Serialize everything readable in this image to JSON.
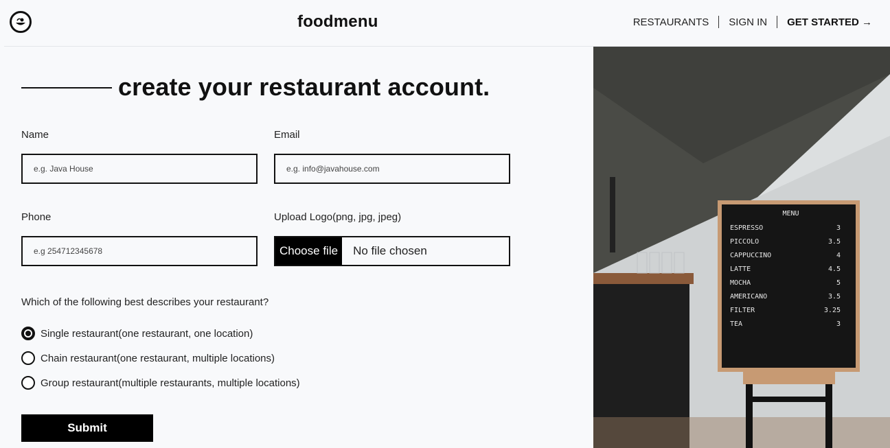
{
  "header": {
    "brand": "foodmenu",
    "nav": {
      "restaurants": "RESTAURANTS",
      "sign_in": "SIGN IN",
      "get_started": "GET STARTED →"
    }
  },
  "form": {
    "title": "create your restaurant account.",
    "name": {
      "label": "Name",
      "placeholder": "e.g. Java House",
      "value": ""
    },
    "email": {
      "label": "Email",
      "placeholder": "e.g. info@javahouse.com",
      "value": ""
    },
    "phone": {
      "label": "Phone",
      "placeholder": "e.g 254712345678",
      "value": ""
    },
    "logo": {
      "label": "Upload Logo(png, jpg, jpeg)",
      "button": "Choose file",
      "status": "No file chosen"
    },
    "question": "Which of the following best describes your restaurant?",
    "options": [
      {
        "label": "Single restaurant(one restaurant, one location)",
        "checked": true
      },
      {
        "label": "Chain restaurant(one restaurant, multiple locations)",
        "checked": false
      },
      {
        "label": "Group restaurant(multiple restaurants, multiple locations)",
        "checked": false
      }
    ],
    "submit": "Submit"
  },
  "photo": {
    "menu_title": "MENU",
    "items": [
      {
        "name": "ESPRESSO",
        "price": "3"
      },
      {
        "name": "PICCOLO",
        "price": "3.5"
      },
      {
        "name": "CAPPUCCINO",
        "price": "4"
      },
      {
        "name": "LATTE",
        "price": "4.5"
      },
      {
        "name": "MOCHA",
        "price": "5"
      },
      {
        "name": "AMERICANO",
        "price": "3.5"
      },
      {
        "name": "FILTER",
        "price": "3.25"
      },
      {
        "name": "TEA",
        "price": "3"
      }
    ]
  }
}
